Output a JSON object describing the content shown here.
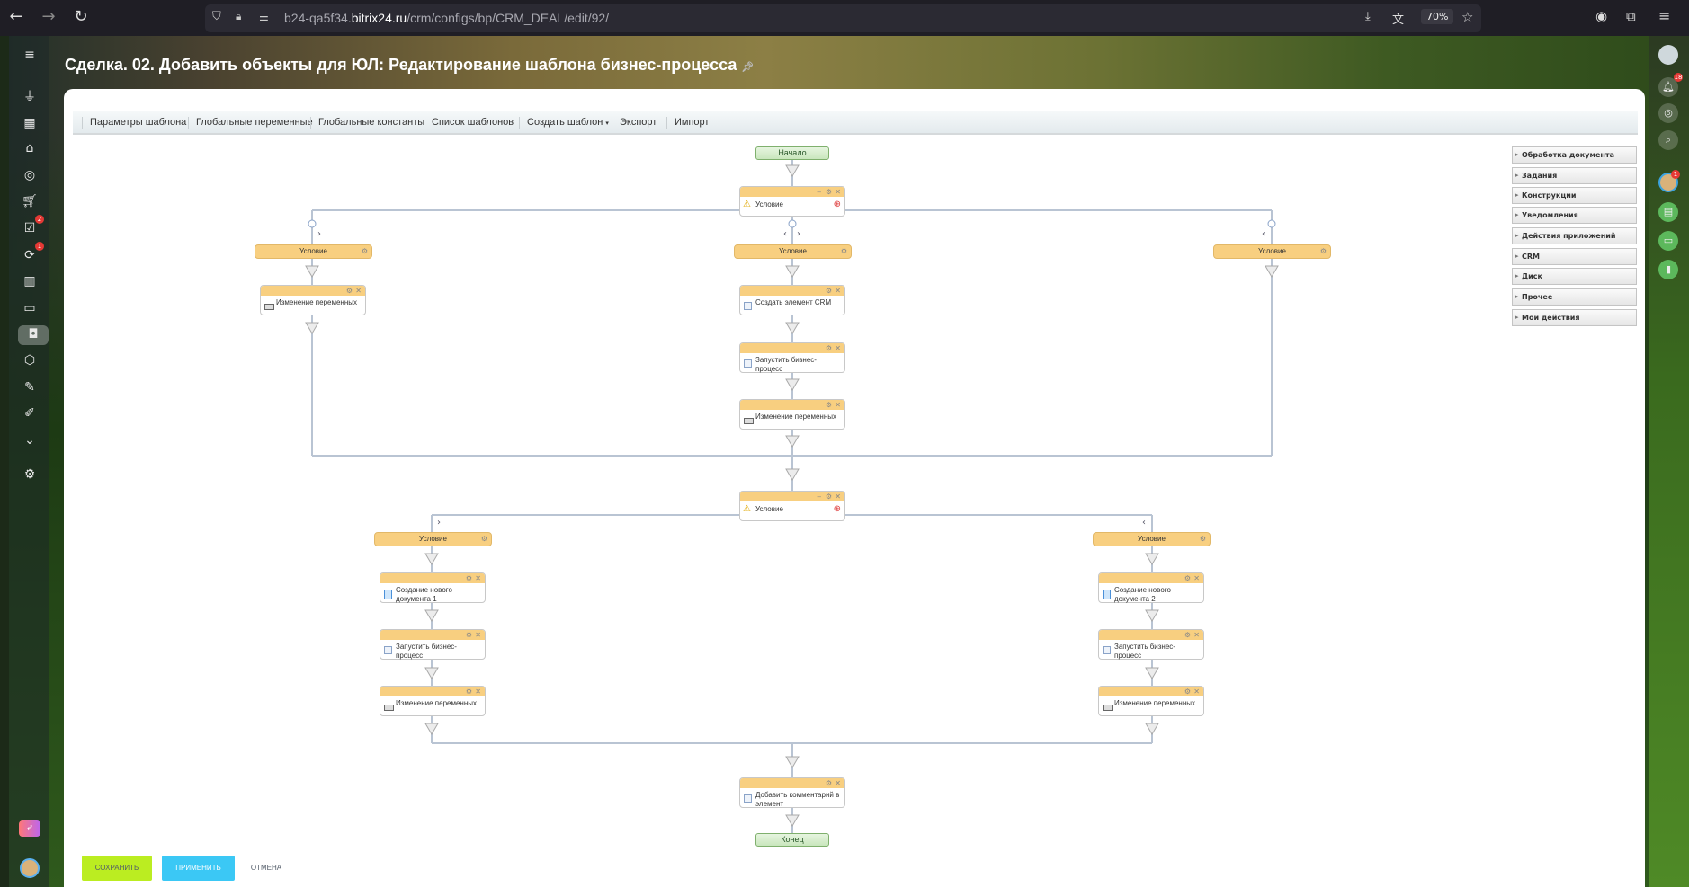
{
  "browser": {
    "url_prefix": "b24-qa5f34.",
    "url_domain": "bitrix24.ru",
    "url_path": "/crm/configs/bp/CRM_DEAL/edit/92/",
    "zoom": "70%"
  },
  "page": {
    "title": "Сделка. 02. Добавить объекты для ЮЛ: Редактирование шаблона бизнес-процесса"
  },
  "sidebar": {
    "badges": {
      "tasks": "2",
      "processes": "1"
    }
  },
  "toolbar": {
    "items": [
      "Параметры шаблона",
      "Глобальные переменные",
      "Глобальные константы",
      "Список шаблонов",
      "Создать шаблон",
      "Экспорт",
      "Импорт"
    ]
  },
  "diagram": {
    "start": "Начало",
    "end": "Конец",
    "condition1": "Условие",
    "branches1": [
      "Условие",
      "Условие",
      "Условие"
    ],
    "left_activities": [
      "Изменение переменных"
    ],
    "middle_activities": [
      "Создать элемент CRM",
      "Запустить бизнес-процесс",
      "Изменение переменных"
    ],
    "condition2": "Условие",
    "branches2": [
      "Условие",
      "Условие"
    ],
    "b2_left": [
      "Создание нового документа 1",
      "Запустить бизнес-процесс",
      "Изменение переменных"
    ],
    "b2_right": [
      "Создание нового документа 2",
      "Запустить бизнес-процесс",
      "Изменение переменных"
    ],
    "final_activity": "Добавить комментарий в элемент"
  },
  "palette": {
    "groups": [
      "Обработка документа",
      "Задания",
      "Конструкции",
      "Уведомления",
      "Действия приложений",
      "CRM",
      "Диск",
      "Прочее",
      "Мои действия"
    ]
  },
  "footer": {
    "save": "СОХРАНИТЬ",
    "apply": "ПРИМЕНИТЬ",
    "cancel": "ОТМЕНА"
  },
  "right_rail": {
    "notifications_badge": "18",
    "avatar_badge": "1"
  }
}
